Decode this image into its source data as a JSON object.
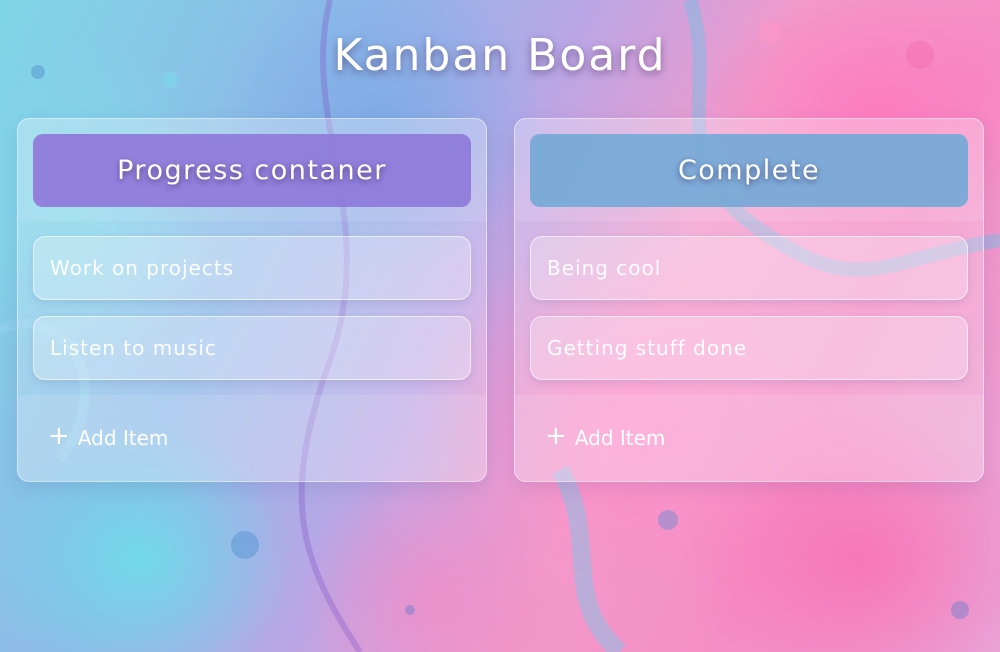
{
  "page": {
    "title": "Kanban Board"
  },
  "columns": [
    {
      "header": "Progress contaner",
      "header_color": "#8f7bda",
      "items": [
        "Work on projects",
        "Listen to music"
      ],
      "add_label": "Add Item",
      "add_icon": "plus-icon"
    },
    {
      "header": "Complete",
      "header_color": "#78aad7",
      "items": [
        "Being cool",
        "Getting stuff done"
      ],
      "add_label": "Add Item",
      "add_icon": "plus-icon"
    }
  ]
}
